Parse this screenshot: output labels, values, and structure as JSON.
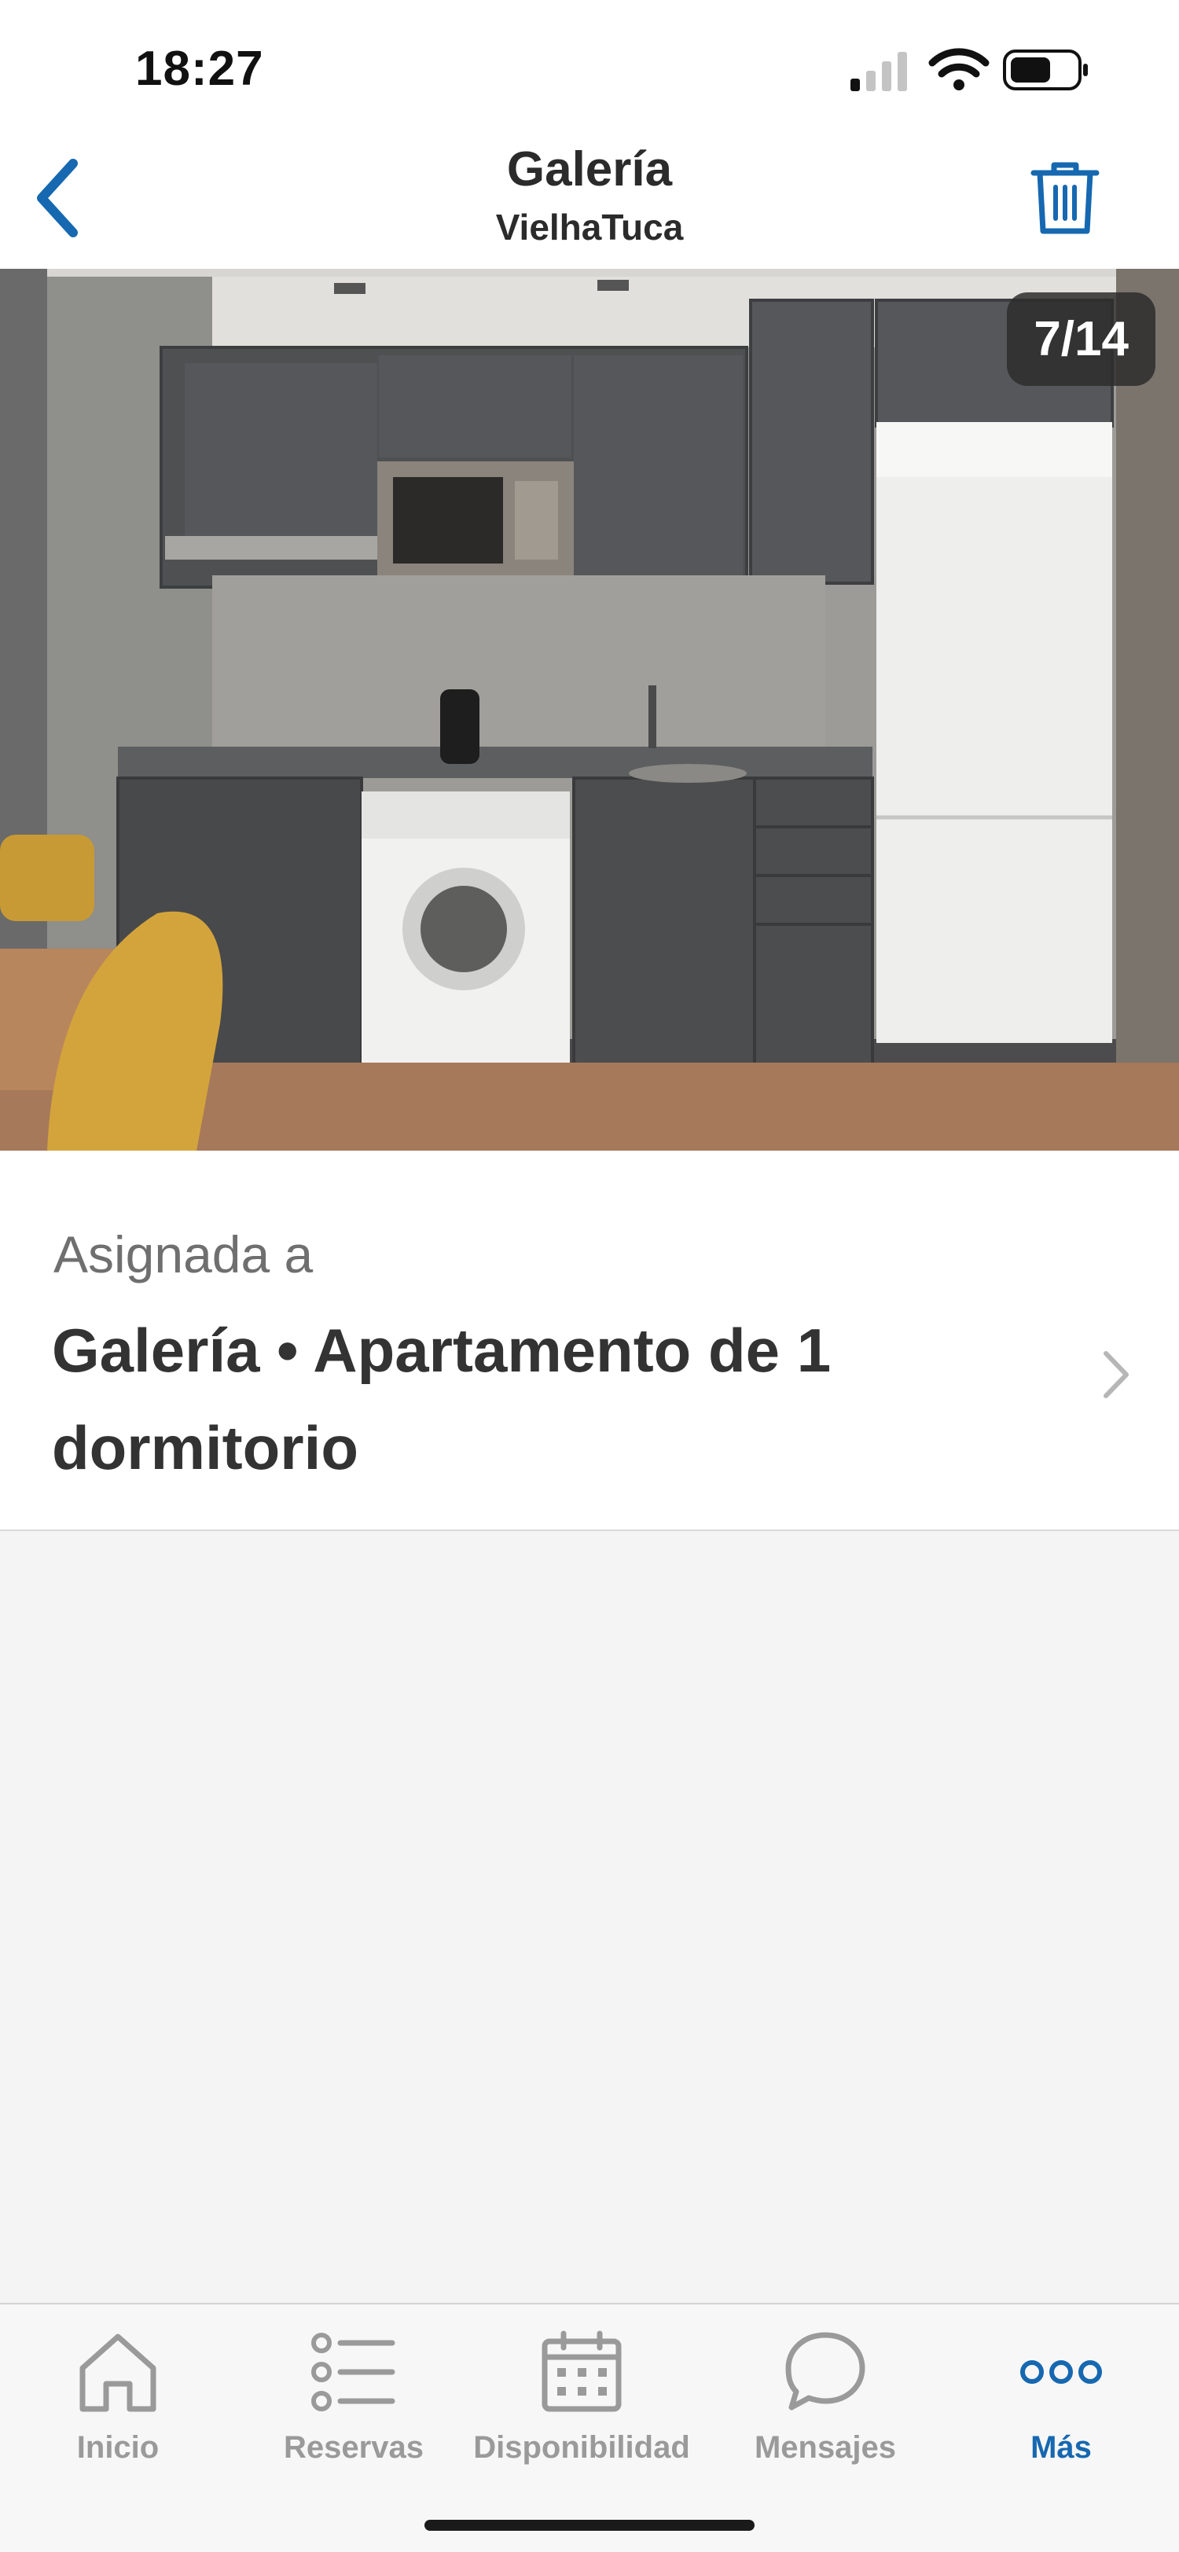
{
  "status_bar": {
    "time": "18:27"
  },
  "header": {
    "title": "Galería",
    "subtitle": "VielhaTuca"
  },
  "photo": {
    "index": "7/14"
  },
  "assignment": {
    "label": "Asignada a",
    "value": "Galería • Apartamento de 1 dormitorio"
  },
  "tabs": [
    {
      "label": "Inicio",
      "icon": "home-icon"
    },
    {
      "label": "Reservas",
      "icon": "list-icon"
    },
    {
      "label": "Disponibilidad",
      "icon": "calendar-icon"
    },
    {
      "label": "Mensajes",
      "icon": "chat-bubble-icon"
    },
    {
      "label": "Más",
      "icon": "more-dots-icon",
      "active": true
    }
  ],
  "colors": {
    "accent": "#1668b0",
    "tab_inactive": "#9a9a9a",
    "text": "#2b2b2b"
  }
}
